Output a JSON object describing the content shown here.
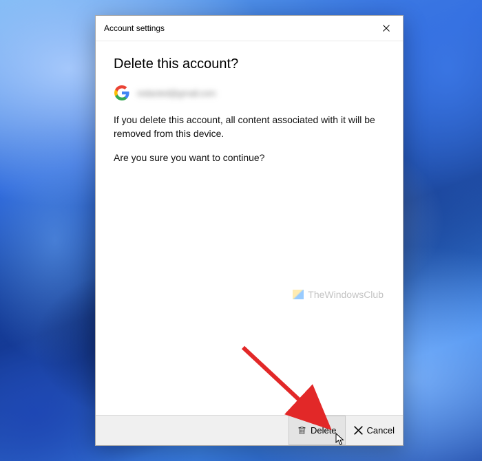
{
  "titlebar": {
    "title": "Account settings"
  },
  "dialog": {
    "heading": "Delete this account?",
    "account_email": "redacted@gmail.com",
    "warning": "If you delete this account, all content associated with it will be removed from this device.",
    "confirm": "Are you sure you want to continue?"
  },
  "footer": {
    "delete_label": "Delete",
    "cancel_label": "Cancel"
  },
  "watermark": {
    "text": "TheWindowsClub"
  },
  "colors": {
    "google_blue": "#4285F4",
    "google_red": "#EA4335",
    "google_yellow": "#FBBC05",
    "google_green": "#34A853"
  }
}
